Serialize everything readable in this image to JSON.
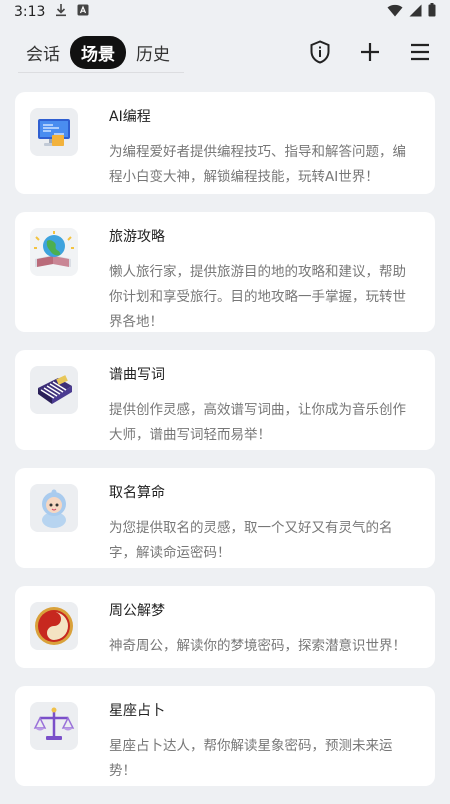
{
  "status_bar": {
    "time": "3:13"
  },
  "tabs": [
    {
      "label": "会话"
    },
    {
      "label": "场景"
    },
    {
      "label": "历史"
    }
  ],
  "header_icons": [
    "shield-info-icon",
    "plus-icon",
    "menu-icon"
  ],
  "scenes": [
    {
      "icon": "ai-coding-icon",
      "title": "AI编程",
      "desc": "为编程爱好者提供编程技巧、指导和解答问题，编程小白变大神，解锁编程技能，玩转AI世界！"
    },
    {
      "icon": "travel-globe-icon",
      "title": "旅游攻略",
      "desc": "懒人旅行家，提供旅游目的地的攻略和建议，帮助你计划和享受旅行。目的地攻略一手掌握，玩转世界各地！"
    },
    {
      "icon": "piano-icon",
      "title": "谱曲写词",
      "desc": "提供创作灵感，高效谱写词曲，让你成为音乐创作大师，谱曲写词轻而易举！"
    },
    {
      "icon": "baby-naming-icon",
      "title": "取名算命",
      "desc": "为您提供取名的灵感，取一个又好又有灵气的名字，解读命运密码！"
    },
    {
      "icon": "yin-yang-icon",
      "title": "周公解梦",
      "desc": "神奇周公，解读你的梦境密码，探索潜意识世界！"
    },
    {
      "icon": "libra-scale-icon",
      "title": "星座占卜",
      "desc": "星座占卜达人，帮你解读星象密码，预测未来运势！"
    }
  ],
  "colors": {
    "background": "#eef0f3",
    "card": "#ffffff",
    "active_tab": "#111111",
    "title_text": "#222222",
    "desc_text": "#777777"
  }
}
